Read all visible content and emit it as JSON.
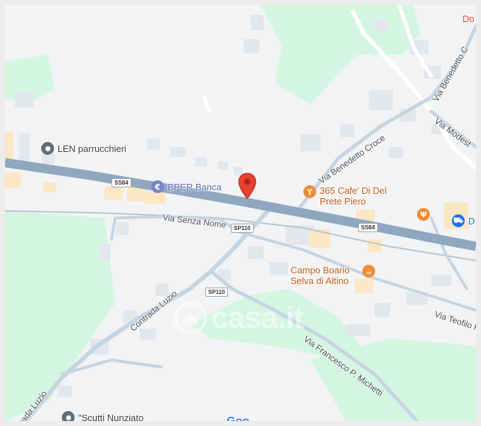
{
  "map": {
    "pois": [
      {
        "key": "len",
        "name": "LEN parrucchieri",
        "icon": "location-icon",
        "color": "#5f6f7a",
        "text_color": "#3c4043"
      },
      {
        "key": "bper",
        "name": "BPER Banca",
        "icon": "euro-icon",
        "color": "#7b86c8",
        "text_color": "#5a6ab8"
      },
      {
        "key": "cafe365",
        "name": "365 Cafe' Di Del Prete Piero",
        "icon": "bar-cocktail-icon",
        "color": "#f28b35",
        "text_color": "#c25b12"
      },
      {
        "key": "campo",
        "name": "Campo Boario Selva di Altino",
        "icon": "cafe-cup-icon",
        "color": "#f28b35",
        "text_color": "#c25b12"
      },
      {
        "key": "scutti",
        "name": "\"Scutti Nunziato",
        "icon": "location-icon",
        "color": "#5f6f7a",
        "text_color": "#3c4043"
      }
    ],
    "unlabeled_icons": [
      {
        "key": "restaurant",
        "icon": "fork-knife-icon",
        "color": "#f28b35"
      },
      {
        "key": "shop",
        "icon": "shopping-cart-icon",
        "color": "#1a73e8"
      }
    ],
    "partial_labels": {
      "top_right": "Do",
      "shop_edge": "D"
    },
    "streets": {
      "via_benedetto_croce": "Via Benedetto Croce",
      "via_benedetto_c_edge": "Via Benedetto C",
      "via_modest": "Via Modest",
      "via_senza_nome": "Via Senza Nome",
      "contrada_luzio": "Contrada Luzio",
      "contrada_luzio_lower": "rada Luzio",
      "via_francesco": "Via Francesco P. Michetti",
      "via_teofilo": "Via Teofilo P"
    },
    "road_shields": {
      "ss84_left": "SS84",
      "ss84_right": "SS84",
      "sp110_upper": "SP110",
      "sp110_lower": "SP110"
    },
    "watermark": "casa.it",
    "google_logo_partial": "Goo",
    "colors": {
      "land": "#f1f3f4",
      "park": "#d4f5e1",
      "highway": "#8fa7bf",
      "road": "#c6d4e1",
      "building": "#e3e7ec",
      "pin": "#e8412f"
    }
  }
}
